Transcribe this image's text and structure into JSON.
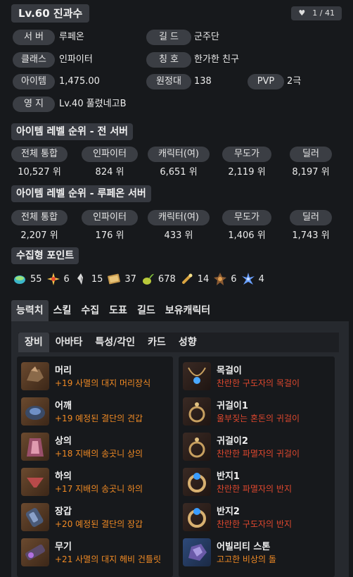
{
  "header": {
    "title": "Lv.60 진과수",
    "page_counter": "1 / 41"
  },
  "profile": {
    "server_label": "서 버",
    "server_value": "루페온",
    "guild_label": "길 드",
    "guild_value": "군주단",
    "class_label": "클래스",
    "class_value": "인파이터",
    "title_label": "칭 호",
    "title_value": "한가한 친구",
    "item_label": "아이템",
    "item_value": "1,475.00",
    "expedition_label": "원정대",
    "expedition_value": "138",
    "pvp_label": "PVP",
    "pvp_value": "2극",
    "territory_label": "영 지",
    "territory_value": "Lv.40 풀렸네고B"
  },
  "rank_all": {
    "title": "아이템 레벨 순위 - 전 서버",
    "cells": [
      {
        "label": "전체 통합",
        "value": "10,527 위"
      },
      {
        "label": "인파이터",
        "value": "824 위"
      },
      {
        "label": "캐릭터(여)",
        "value": "6,651 위"
      },
      {
        "label": "무도가",
        "value": "2,119 위"
      },
      {
        "label": "딜러",
        "value": "8,197 위"
      }
    ]
  },
  "rank_server": {
    "title": "아이템 레벨 순위 - 루페온 서버",
    "cells": [
      {
        "label": "전체 통합",
        "value": "2,207 위"
      },
      {
        "label": "인파이터",
        "value": "176 위"
      },
      {
        "label": "캐릭터(여)",
        "value": "433 위"
      },
      {
        "label": "무도가",
        "value": "1,406 위"
      },
      {
        "label": "딜러",
        "value": "1,743 위"
      }
    ]
  },
  "collect": {
    "title": "수집형 포인트",
    "items": [
      {
        "icon": "island-heart-icon",
        "value": "55"
      },
      {
        "icon": "giant-heart-icon",
        "value": "6"
      },
      {
        "icon": "art-icon",
        "value": "15"
      },
      {
        "icon": "adventure-book-icon",
        "value": "37"
      },
      {
        "icon": "mokoko-seed-icon",
        "value": "678"
      },
      {
        "icon": "ignea-token-icon",
        "value": "14"
      },
      {
        "icon": "orpheus-star-icon",
        "value": "6"
      },
      {
        "icon": "world-tree-leaf-icon",
        "value": "4"
      }
    ]
  },
  "tabs": [
    "능력치",
    "스킬",
    "수집",
    "도표",
    "길드",
    "보유캐릭터"
  ],
  "sub_tabs": [
    "장비",
    "아바타",
    "특성/각인",
    "카드",
    "성향"
  ],
  "equipment_left": [
    {
      "slot": "머리",
      "desc": "+19 사멸의 대지 머리장식",
      "color": "orange"
    },
    {
      "slot": "어깨",
      "desc": "+19 예정된 결단의 견갑",
      "color": "orange"
    },
    {
      "slot": "상의",
      "desc": "+18 지배의 송곳니 상의",
      "color": "orange"
    },
    {
      "slot": "하의",
      "desc": "+17 지배의 송곳니 하의",
      "color": "orange"
    },
    {
      "slot": "장갑",
      "desc": "+20 예정된 결단의 장갑",
      "color": "orange"
    },
    {
      "slot": "무기",
      "desc": "+21 사멸의 대지 헤비 건틀릿",
      "color": "orange"
    }
  ],
  "equipment_right": [
    {
      "slot": "목걸이",
      "desc": "찬란한 구도자의 목걸이",
      "color": "red"
    },
    {
      "slot": "귀걸이1",
      "desc": "울부짖는 혼돈의 귀걸이",
      "color": "red"
    },
    {
      "slot": "귀걸이2",
      "desc": "찬란한 파멸자의 귀걸이",
      "color": "red"
    },
    {
      "slot": "반지1",
      "desc": "찬란한 파멸자의 반지",
      "color": "red"
    },
    {
      "slot": "반지2",
      "desc": "찬란한 구도자의 반지",
      "color": "red"
    },
    {
      "slot": "어빌리티 스톤",
      "desc": "고고한 비상의 돌",
      "color": "orange"
    }
  ]
}
